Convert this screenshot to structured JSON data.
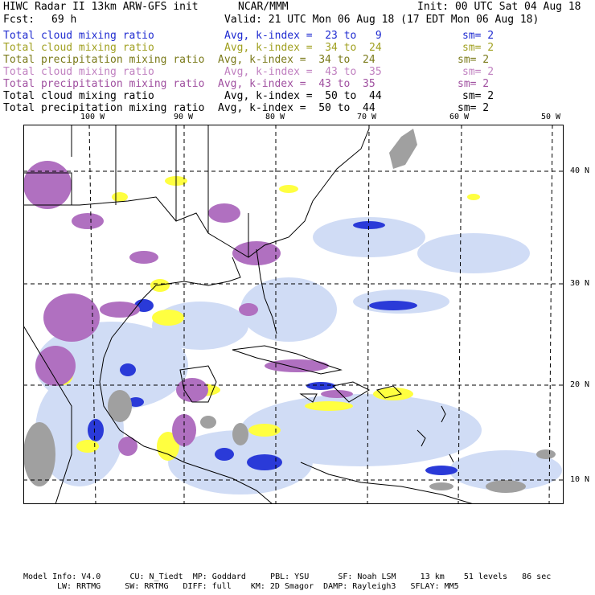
{
  "header": {
    "title": "HIWC Radar II 13km ARW-GFS init",
    "org": "NCAR/MMM",
    "init": "Init: 00 UTC Sat 04 Aug 18",
    "fcst_label": "Fcst:",
    "fcst_value": "69 h",
    "valid": "Valid: 21 UTC Mon 06 Aug 18 (17 EDT Mon 06 Aug 18)"
  },
  "fields": [
    {
      "name": "Total cloud mixing ratio",
      "avg": "Avg, k-index =  23 to   9",
      "sm": "sm= 2",
      "color": "#1f2bd0"
    },
    {
      "name": "Total cloud mixing ratio",
      "avg": "Avg, k-index =  34 to  24",
      "sm": "sm= 2",
      "color": "#a0a020"
    },
    {
      "name": "Total precipitation mixing ratio",
      "avg": "Avg, k-index =  34 to  24",
      "sm": "sm= 2",
      "color": "#7a7a1a"
    },
    {
      "name": "Total cloud mixing ratio",
      "avg": "Avg, k-index =  43 to  35",
      "sm": "sm= 2",
      "color": "#c080c0"
    },
    {
      "name": "Total precipitation mixing ratio",
      "avg": "Avg, k-index =  43 to  35",
      "sm": "sm= 2",
      "color": "#a050a0"
    },
    {
      "name": "Total cloud mixing ratio",
      "avg": "Avg, k-index =  50 to  44",
      "sm": "sm= 2",
      "color": "#000000"
    },
    {
      "name": "Total precipitation mixing ratio",
      "avg": "Avg, k-index =  50 to  44",
      "sm": "sm= 2",
      "color": "#000000"
    }
  ],
  "map": {
    "lon_labels": [
      "100 W",
      "90 W",
      "80 W",
      "70 W",
      "60 W",
      "50 W"
    ],
    "lat_labels": [
      "40 N",
      "30 N",
      "20 N",
      "10 N"
    ],
    "colors": {
      "land_outline": "#000000",
      "blue": "#2030d8",
      "light_blue": "#b8c8f0",
      "yellow": "#ffff40",
      "purple": "#b070c0",
      "gray": "#a0a0a0"
    }
  },
  "footer": {
    "line1": "Model Info: V4.0      CU: N_Tiedt  MP: Goddard     PBL: YSU      SF: Noah LSM     13 km    51 levels   86 sec",
    "line2": "LW: RRTMG     SW: RRTMG   DIFF: full    KM: 2D Smagor  DAMP: Rayleigh3   SFLAY: MM5"
  }
}
